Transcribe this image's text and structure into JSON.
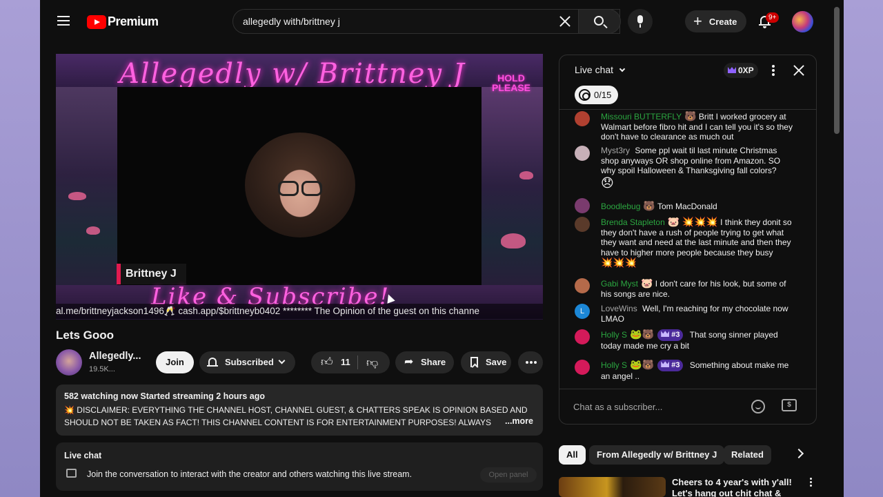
{
  "header": {
    "logo_text": "Premium",
    "search_value": "allegedly with/brittney j",
    "create_label": "Create",
    "notification_count": "9+"
  },
  "player": {
    "overlay_title": "Allegedly w/ Brittney J",
    "hold_please": "HOLD PLEASE",
    "guest_name": "Brittney J",
    "bottom_script": "Like & Subscribe!",
    "ticker": "al.me/brittneyjackson1496🥂 cash.app/$brittneyb0402 ******** The Opinion of the guest on this channe"
  },
  "video": {
    "title": "Lets Gooo",
    "channel_name": "Allegedly...",
    "subscribers": "19.5K...",
    "join_label": "Join",
    "subscribed_label": "Subscribed",
    "like_count": "11",
    "share_label": "Share",
    "save_label": "Save"
  },
  "description": {
    "meta": "582 watching now  Started streaming 2 hours ago",
    "text": "💥 DISCLAIMER: EVERYTHING THE CHANNEL HOST, CHANNEL GUEST, & CHATTERS SPEAK IS OPINION BASED AND SHOULD NOT BE TAKEN AS FACT!  THIS CHANNEL CONTENT IS FOR ENTERTAINMENT PURPOSES!  ALWAYS",
    "more": "...more"
  },
  "live_chat_card": {
    "title": "Live chat",
    "text": "Join the conversation to interact with the creator and others watching this live stream.",
    "open_panel": "Open panel"
  },
  "chat": {
    "title": "Live chat",
    "xp": "0XP",
    "goal": "0/15",
    "input_placeholder": "Chat as a subscriber...",
    "messages": [
      {
        "author": "Missouri BUTTERFLY",
        "badge": "",
        "text": "Britt I worked grocery at Walmart before fibro hit and I can tell you it's so they don't have to clearance as much out",
        "author_color": "#2ba640",
        "avatar_color": "#b04030"
      },
      {
        "author": "Myst3ry",
        "badge": "",
        "text": "Some ppl wait til last minute Christmas shop anyways OR shop online from Amazon. SO why spoil Halloween & Thanksgiving fall colors?",
        "author_color": "#aaaaaa",
        "avatar_color": "#c7b0b8"
      },
      {
        "author": "Boodlebug",
        "badge": "",
        "text": "Tom MacDonald",
        "author_color": "#2ba640",
        "avatar_color": "#7a3b6e"
      },
      {
        "author": "Brenda Stapleton",
        "badge": "",
        "text": "I think they donit so they don't have a rush of people trying to get what they want and need at the last minute and then they have to higher more people because they busy",
        "author_color": "#2ba640",
        "avatar_color": "#5a3a2a"
      },
      {
        "author": "Gabi Myst",
        "badge": "",
        "text": "I don't care for his look, but some of his songs are nice.",
        "author_color": "#2ba640",
        "avatar_color": "#b56a4a"
      },
      {
        "author": "LoveWins",
        "badge": "",
        "text": "Well, I'm reaching for my chocolate now LMAO",
        "author_color": "#aaaaaa",
        "avatar_color": "#1c87d6",
        "avatar_letter": "L"
      },
      {
        "author": "Holly S",
        "badge": "#3",
        "text": "That song sinner played today made me cry a bit",
        "author_color": "#2ba640",
        "avatar_color": "#d41a5a"
      },
      {
        "author": "Holly S",
        "badge": "#3",
        "text": "Something about make me an angel ..",
        "author_color": "#2ba640",
        "avatar_color": "#d41a5a"
      }
    ]
  },
  "chips": [
    {
      "label": "All",
      "active": true
    },
    {
      "label": "From Allegedly w/ Brittney J",
      "active": false
    },
    {
      "label": "Related",
      "active": false
    }
  ],
  "recommendation": {
    "title": "Cheers to 4 year's with y'all! Let's hang out chit chat & watc..."
  },
  "colors": {
    "accent_red": "#ff0000",
    "chat_author_green": "#2ba640",
    "badge_purple": "#4b2a9a",
    "overlay_pink": "#ff61e0"
  },
  "icons": [
    "menu-icon",
    "youtube-logo-icon",
    "clear-icon",
    "search-icon",
    "mic-icon",
    "plus-icon",
    "bell-icon",
    "bell-small-icon",
    "chevron-down-icon",
    "thumb-up-icon",
    "thumb-down-icon",
    "share-icon",
    "bookmark-icon",
    "more-horizontal-icon",
    "more-vertical-icon",
    "close-icon",
    "crown-icon",
    "goal-icon",
    "emoji-icon",
    "super-chat-icon",
    "chevron-right-icon",
    "chat-bubble-icon"
  ]
}
